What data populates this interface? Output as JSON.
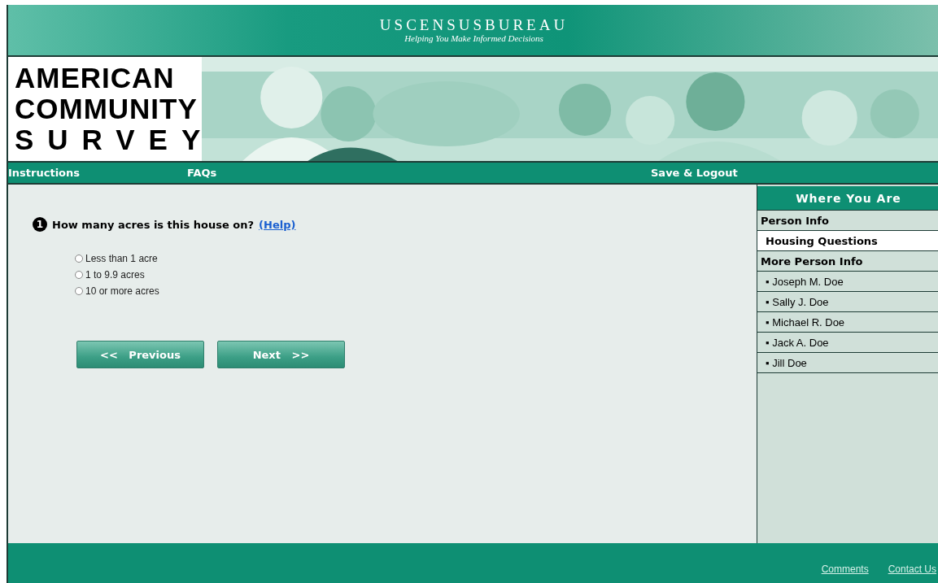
{
  "header": {
    "agency": "USCENSUSBUREAU",
    "tagline": "Helping You Make Informed Decisions"
  },
  "banner": {
    "logo_lines": [
      "AMERICAN",
      "COMMUNITY",
      "SURVEY"
    ]
  },
  "nav": [
    {
      "label": "Instructions"
    },
    {
      "label": "FAQs"
    },
    {
      "label": "Save & Logout"
    }
  ],
  "question": {
    "number": "1",
    "text": "How many acres is this house on?",
    "help": "(Help)",
    "options": [
      {
        "label": "Less than 1 acre",
        "selected": false
      },
      {
        "label": "1 to 9.9 acres",
        "selected": false
      },
      {
        "label": "10 or more acres",
        "selected": false
      }
    ]
  },
  "buttons": [
    "<<   Previous",
    "Next   >>"
  ],
  "sidebar": {
    "title": "Where You Are",
    "items": [
      {
        "kind": "section",
        "label": "Person Info",
        "selected": false
      },
      {
        "kind": "section",
        "label": "Housing Questions",
        "selected": true
      },
      {
        "kind": "section",
        "label": "More Person Info",
        "selected": false
      },
      {
        "kind": "person",
        "label": "▪ Joseph M. Doe",
        "selected": false
      },
      {
        "kind": "person",
        "label": "▪ Sally J. Doe",
        "selected": false
      },
      {
        "kind": "person",
        "label": "▪ Michael R. Doe",
        "selected": false
      },
      {
        "kind": "person",
        "label": "▪ Jack A. Doe",
        "selected": false
      },
      {
        "kind": "person",
        "label": "▪ Jill Doe",
        "selected": false
      }
    ]
  },
  "footer": {
    "links": [
      "Comments",
      "Contact Us"
    ]
  }
}
